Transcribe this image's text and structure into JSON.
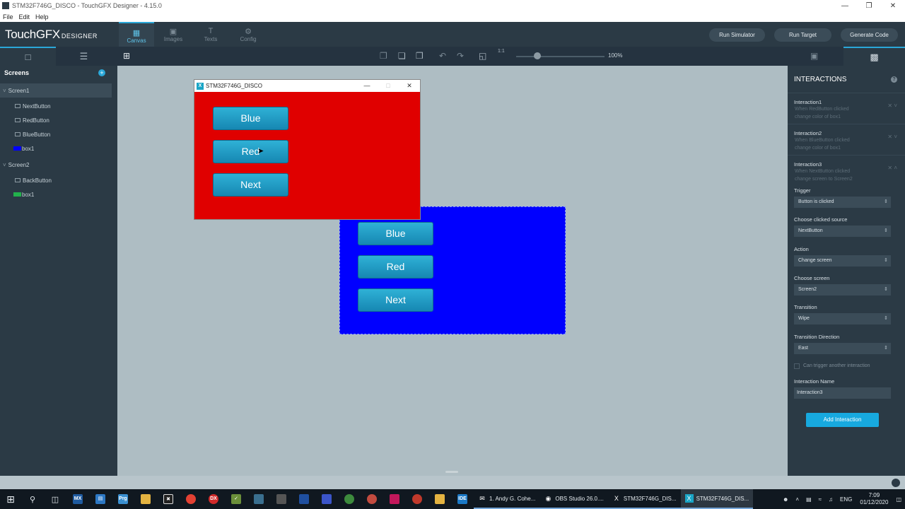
{
  "window": {
    "title": "STM32F746G_DISCO - TouchGFX Designer - 4.15.0"
  },
  "menu": [
    "File",
    "Edit",
    "Help"
  ],
  "brand": {
    "name": "TouchGFX",
    "sub": "DESIGNER"
  },
  "nav_tabs": [
    {
      "label": "Canvas",
      "icon": "canvas-icon"
    },
    {
      "label": "Images",
      "icon": "images-icon"
    },
    {
      "label": "Texts",
      "icon": "texts-icon"
    },
    {
      "label": "Config",
      "icon": "config-icon"
    }
  ],
  "header_buttons": {
    "run_simulator": "Run Simulator",
    "run_target": "Run Target",
    "generate_code": "Generate Code"
  },
  "toolbar": {
    "zoom": "100%",
    "zoom_ratio": "1:1"
  },
  "screens_panel": {
    "title": "Screens",
    "items": [
      {
        "label": "Screen1",
        "type": "screen"
      },
      {
        "label": "NextButton",
        "type": "widget"
      },
      {
        "label": "RedButton",
        "type": "widget"
      },
      {
        "label": "BlueButton",
        "type": "widget"
      },
      {
        "label": "box1",
        "type": "box",
        "color": "#0000ff"
      },
      {
        "label": "Screen2",
        "type": "screen"
      },
      {
        "label": "BackButton",
        "type": "widget"
      },
      {
        "label": "box1",
        "type": "box",
        "color": "#22b14c"
      }
    ]
  },
  "simulator": {
    "title": "STM32F746G_DISCO",
    "buttons": [
      "Blue",
      "Red",
      "Next"
    ],
    "background": "#e00000"
  },
  "canvas_screen": {
    "buttons": [
      "Blue",
      "Red",
      "Next"
    ],
    "background": "#0000ff"
  },
  "interactions": {
    "title": "INTERACTIONS",
    "list": [
      {
        "name": "Interaction1",
        "desc1": "When RedButton clicked",
        "desc2": "change color of box1"
      },
      {
        "name": "Interaction2",
        "desc1": "When BlueButton clicked",
        "desc2": "change color of box1"
      },
      {
        "name": "Interaction3",
        "desc1": "When NextButton clicked",
        "desc2": "change screen to Screen2"
      }
    ],
    "fields": {
      "trigger_label": "Trigger",
      "trigger_value": "Button is clicked",
      "source_label": "Choose clicked source",
      "source_value": "NextButton",
      "action_label": "Action",
      "action_value": "Change screen",
      "screen_label": "Choose screen",
      "screen_value": "Screen2",
      "transition_label": "Transition",
      "transition_value": "Wipe",
      "direction_label": "Transition Direction",
      "direction_value": "East",
      "can_trigger_label": "Can trigger another interaction",
      "name_label": "Interaction Name",
      "name_value": "Interaction3"
    },
    "add_button": "Add Interaction"
  },
  "taskbar": {
    "apps": [
      {
        "label": "1. Andy G. Cohe...",
        "icon": "mail-icon"
      },
      {
        "label": "OBS Studio 26.0....",
        "icon": "obs-icon"
      },
      {
        "label": "STM32F746G_DIS...",
        "icon": "touchgfx-icon"
      },
      {
        "label": "STM32F746G_DIS...",
        "icon": "touchgfx-icon"
      }
    ],
    "lang": "ENG",
    "time": "7:09",
    "date": "01/12/2020"
  },
  "colors": {
    "accent": "#2aa7d8",
    "panel": "#2b3a45",
    "canvas": "#aebdc3"
  }
}
